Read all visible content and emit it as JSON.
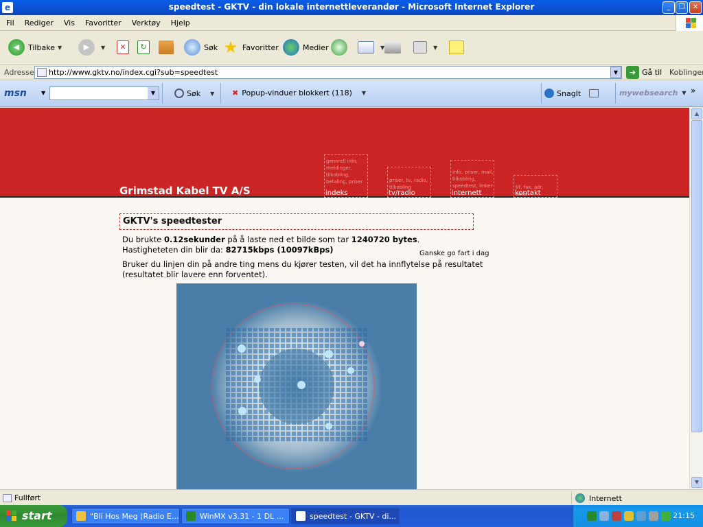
{
  "window": {
    "title": "speedtest - GKTV - din lokale internettleverandør - Microsoft Internet Explorer"
  },
  "menu": [
    "Fil",
    "Rediger",
    "Vis",
    "Favoritter",
    "Verktøy",
    "Hjelp"
  ],
  "toolbar": {
    "back": "Tilbake",
    "search": "Søk",
    "favorites": "Favoritter",
    "media": "Medier"
  },
  "address": {
    "label": "Adresse",
    "url": "http://www.gktv.no/index.cgi?sub=speedtest",
    "go": "Gå til",
    "links": "Koblinger"
  },
  "msn": {
    "logo": "msn",
    "search": "Søk",
    "popup": "Popup-vinduer blokkert (118)",
    "snagit": "SnagIt",
    "websearch": "mywebsearch"
  },
  "site": {
    "name": "Grimstad Kabel TV A/S",
    "nav": [
      {
        "label": "indeks",
        "sub": "generell info, meldinger, tilkobling, betaling, priser"
      },
      {
        "label": "tv/radio",
        "sub": "priser, tv, radio, tilkobling"
      },
      {
        "label": "internett",
        "sub": "info, priser, mail, tilkobling, speedtest, linker"
      },
      {
        "label": "kontakt",
        "sub": "tlf, fax, adr, email"
      }
    ]
  },
  "speedtest": {
    "heading": "GKTV's speedtester",
    "line1_a": "Du brukte ",
    "line1_time": "0.12sekunder",
    "line1_b": " på å laste ned et bilde som tar ",
    "line1_bytes": "1240720 bytes",
    "line1_c": ".",
    "line2_a": "Hastigheteten din blir da: ",
    "line2_speed": "82715kbps (10097kBps)",
    "note1": "Bruker du linjen din på andre ting mens du kjører testen, vil det ha innflytelse på resultatet",
    "note2": "(resultatet blir lavere enn forventet).",
    "verdict": "Ganske go fart i dag"
  },
  "status": {
    "text": "Fullført",
    "zone": "Internett"
  },
  "taskbar": {
    "start": "start",
    "tasks": [
      "\"Bli Hos Meg (Radio E...",
      "WinMX v3.31 - 1 DL ...",
      "speedtest - GKTV - di..."
    ],
    "clock": "21:15"
  }
}
